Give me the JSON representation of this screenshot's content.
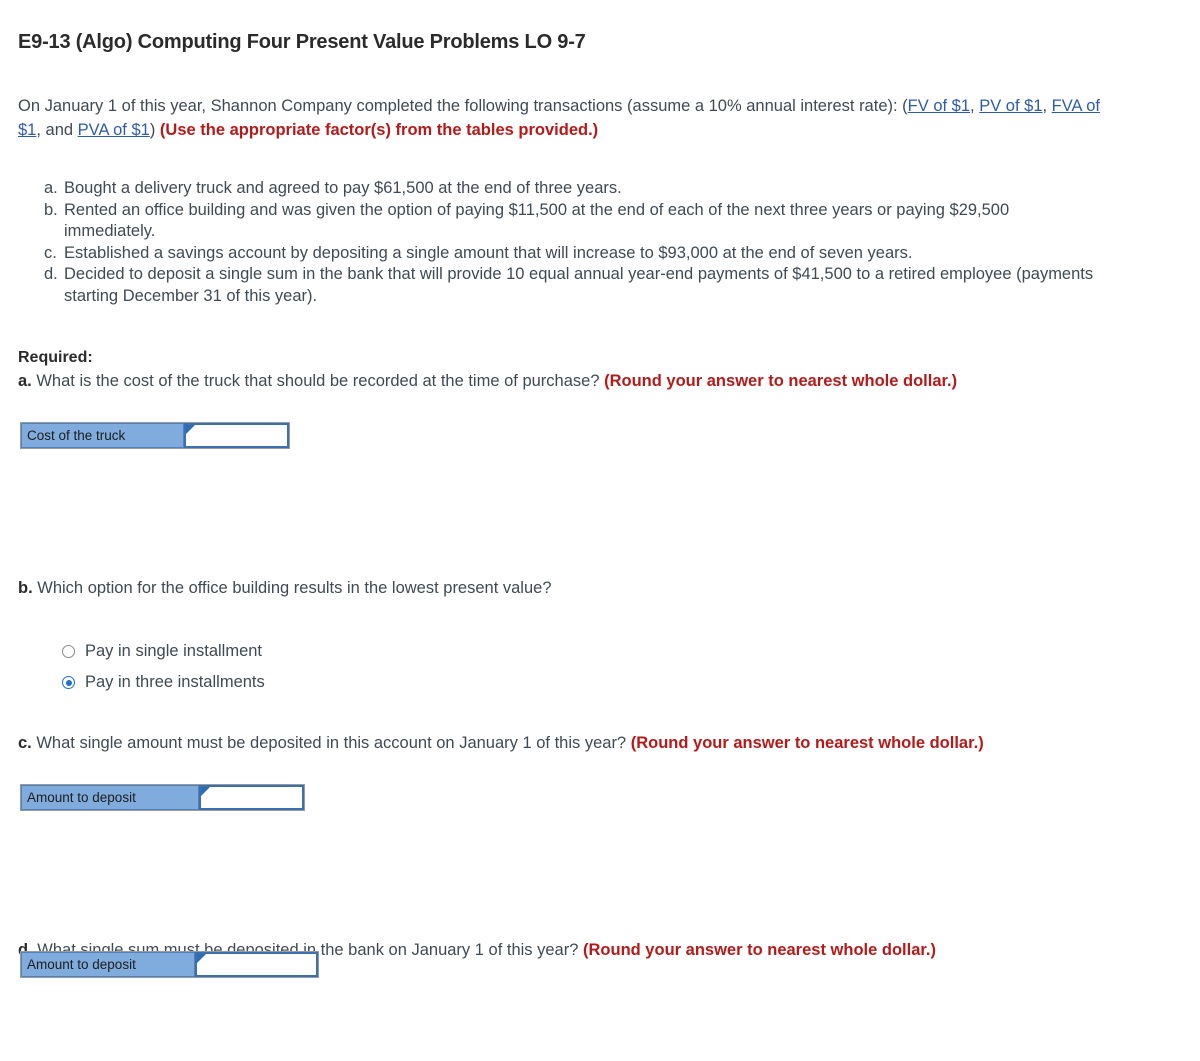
{
  "title": "E9-13 (Algo) Computing Four Present Value Problems LO 9-7",
  "intro": {
    "lead": "On January 1 of this year, Shannon Company completed the following transactions (assume a 10% annual interest rate): (",
    "links": [
      "FV of $1",
      "PV of $1",
      "FVA of $1",
      "PVA of $1"
    ],
    "sep1": ", ",
    "sep2": ", ",
    "sep3": ", and ",
    "close": ") ",
    "note": "(Use the appropriate factor(s) from the tables provided.)"
  },
  "transactions": [
    {
      "marker": "a.",
      "text": "Bought a delivery truck and agreed to pay $61,500 at the end of three years."
    },
    {
      "marker": "b.",
      "text": "Rented an office building and was given the option of paying $11,500 at the end of each of the next three years or paying $29,500 immediately."
    },
    {
      "marker": "c.",
      "text": "Established a savings account by depositing a single amount that will increase to $93,000 at the end of seven years."
    },
    {
      "marker": "d.",
      "text": "Decided to deposit a single sum in the bank that will provide 10 equal annual year-end payments of $41,500 to a retired employee (payments starting December 31 of this year)."
    }
  ],
  "required_label": "Required:",
  "questions": {
    "a": {
      "marker": "a.",
      "text": "What is the cost of the truck that should be recorded at the time of purchase?",
      "note": "(Round your answer to nearest whole dollar.)",
      "row_label": "Cost of the truck",
      "value": "",
      "placeholder": ""
    },
    "b": {
      "marker": "b.",
      "text": "Which option for the office building results in the lowest present value?",
      "note": "",
      "options": [
        {
          "label": "Pay in single installment",
          "selected": false
        },
        {
          "label": "Pay in three installments",
          "selected": true
        }
      ]
    },
    "c": {
      "marker": "c.",
      "text": "What single amount must be deposited in this account on January 1 of this year?",
      "note": "(Round your answer to nearest whole dollar.)",
      "row_label": "Amount to deposit",
      "value": "",
      "placeholder": ""
    },
    "d": {
      "marker": "d.",
      "text": "What single sum must be deposited in the bank on January 1 of this year?",
      "note": "(Round your answer to nearest whole dollar.)",
      "row_label": "Amount to deposit",
      "value": "",
      "placeholder": ""
    }
  },
  "colors": {
    "link": "#2d5ba8",
    "note_red": "#b51a1a",
    "header_blue": "#7fabdd",
    "cell_border": "#3a6fb0",
    "radio_selected": "#1a73c8",
    "body_text": "#3f4a54"
  }
}
